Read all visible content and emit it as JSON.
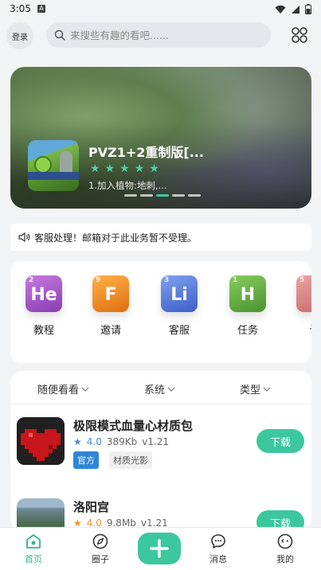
{
  "status_bar": {
    "time": "3:05"
  },
  "topbar": {
    "login_label": "登录",
    "search_placeholder": "来搜些有趣的看吧......"
  },
  "banner": {
    "title": "PVZ1+2重制版[...",
    "stars": 5,
    "description": "1.加入植物:地刺,...",
    "page_count": 5,
    "active_index": 2
  },
  "notice": {
    "text": "客服处理！邮箱对于此业务暂不受理。"
  },
  "categories": [
    {
      "number": "2",
      "symbol": "He",
      "label": "教程",
      "color": "#a84fc9"
    },
    {
      "number": "9",
      "symbol": "F",
      "label": "邀请",
      "color": "#f08a1c"
    },
    {
      "number": "3",
      "symbol": "Li",
      "label": "客服",
      "color": "#4c74dc"
    },
    {
      "number": "1",
      "symbol": "H",
      "label": "任务",
      "color": "#5aa63a"
    },
    {
      "number": "5",
      "symbol": "",
      "label": "认",
      "color": "#d98080"
    }
  ],
  "filters": [
    {
      "label": "随便看看"
    },
    {
      "label": "系统"
    },
    {
      "label": "类型"
    }
  ],
  "apps": [
    {
      "name": "极限模式血量心材质包",
      "rating": "4.0",
      "size": "389Kb",
      "version": "v1.21",
      "tags": [
        "官方",
        "材质光影"
      ],
      "button": "下载"
    },
    {
      "name": "洛阳宫",
      "rating": "4.0",
      "size": "9.8Mb",
      "version": "v1.21",
      "tags": [],
      "button": "下载"
    }
  ],
  "bottom_nav": [
    {
      "label": "首页",
      "icon": "home-icon",
      "active": true
    },
    {
      "label": "圈子",
      "icon": "compass-icon",
      "active": false
    },
    {
      "label": "消息",
      "icon": "chat-icon",
      "active": false
    },
    {
      "label": "我的",
      "icon": "profile-icon",
      "active": false
    }
  ],
  "colors": {
    "accent": "#3cc79f",
    "active_nav": "#2fb587",
    "official_tag": "#2f86d8"
  }
}
